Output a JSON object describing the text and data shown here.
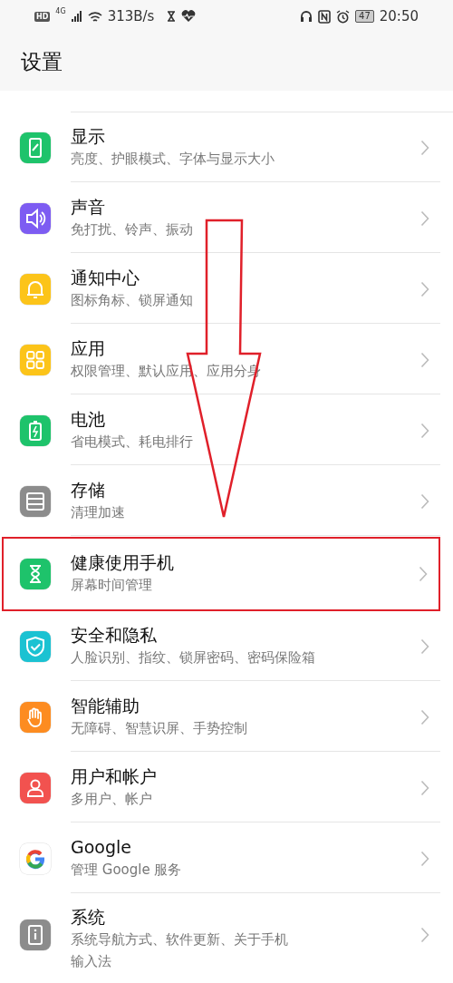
{
  "status_bar": {
    "hd": "HD",
    "network": "4G",
    "speed": "313B/s",
    "battery": "47",
    "time": "20:50"
  },
  "title": "设置",
  "items": [
    {
      "kind": "display",
      "color": "#1ec36b",
      "title": "显示",
      "subtitle": "亮度、护眼模式、字体与显示大小",
      "highlighted": false
    },
    {
      "kind": "sound",
      "color": "#7d5cf2",
      "title": "声音",
      "subtitle": "免打扰、铃声、振动",
      "highlighted": false
    },
    {
      "kind": "bell",
      "color": "#fcc419",
      "title": "通知中心",
      "subtitle": "图标角标、锁屏通知",
      "highlighted": false
    },
    {
      "kind": "apps",
      "color": "#fcc419",
      "title": "应用",
      "subtitle": "权限管理、默认应用、应用分身",
      "highlighted": false
    },
    {
      "kind": "battery",
      "color": "#1ec36b",
      "title": "电池",
      "subtitle": "省电模式、耗电排行",
      "highlighted": false
    },
    {
      "kind": "storage",
      "color": "#8c8c8c",
      "title": "存储",
      "subtitle": "清理加速",
      "highlighted": false
    },
    {
      "kind": "hourglass",
      "color": "#1ec36b",
      "title": "健康使用手机",
      "subtitle": "屏幕时间管理",
      "highlighted": true
    },
    {
      "kind": "shield",
      "color": "#1bc2d2",
      "title": "安全和隐私",
      "subtitle": "人脸识别、指纹、锁屏密码、密码保险箱",
      "highlighted": false
    },
    {
      "kind": "hand",
      "color": "#fd8c21",
      "title": "智能辅助",
      "subtitle": "无障碍、智慧识屏、手势控制",
      "highlighted": false
    },
    {
      "kind": "user",
      "color": "#f2524f",
      "title": "用户和帐户",
      "subtitle": "多用户、帐户",
      "highlighted": false
    },
    {
      "kind": "google",
      "color": "#ffffff",
      "title": "Google",
      "subtitle": "管理 Google 服务",
      "highlighted": false
    },
    {
      "kind": "system",
      "color": "#8c8c8c",
      "title": "系统",
      "subtitle": "系统导航方式、软件更新、关于手机输入法",
      "highlighted": false
    }
  ]
}
